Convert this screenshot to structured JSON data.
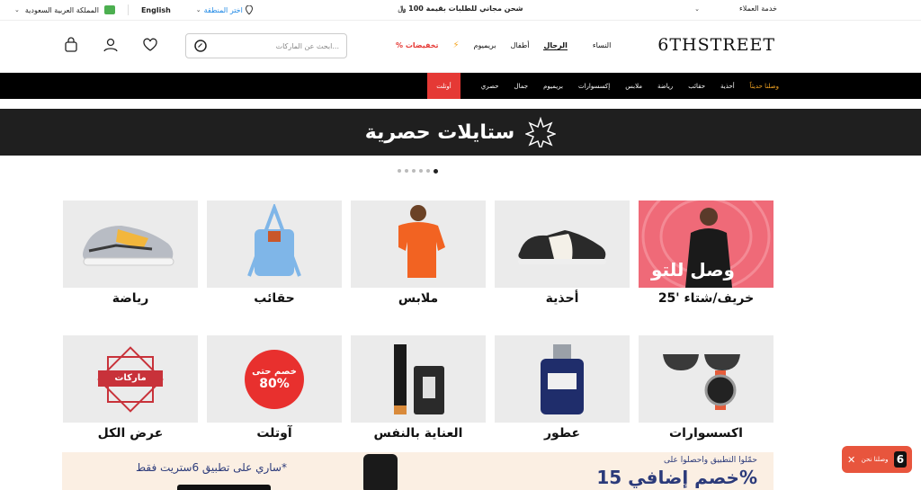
{
  "topbar": {
    "country": "المملكة العربية السعودية",
    "language": "English",
    "region": "اختر المنطقة",
    "shipping": "شحن مجاني للطلبات بقيمة 100 ﷼",
    "customer_service": "خدمة العملاء"
  },
  "header": {
    "logo": "6THSTREET",
    "search_placeholder": "ابحث عن الماركات...",
    "categories": {
      "women": "النساء",
      "men": "الرجال",
      "kids": "أطفال",
      "premium": "بريميوم",
      "sale": "% تخفيضات"
    }
  },
  "nav": {
    "items": [
      "وصلنا حديثاً",
      "أحذية",
      "حقائب",
      "رياضة",
      "ملابس",
      "إكسسوارات",
      "بريميوم",
      "جمال",
      "حصري"
    ],
    "outlet": "أوتلت"
  },
  "banner": {
    "title": "ستايلات حصرية"
  },
  "carousel": {
    "slides": 6,
    "active": 5
  },
  "tiles": [
    {
      "label": "خريف/شتاء '25",
      "overlay": "وصل للتو"
    },
    {
      "label": "أحذية"
    },
    {
      "label": "ملابس"
    },
    {
      "label": "حقائب"
    },
    {
      "label": "رياضة"
    },
    {
      "label": "اكسسوارات"
    },
    {
      "label": "عطور"
    },
    {
      "label": "العناية بالنفس"
    },
    {
      "label": "آوتلت",
      "badge_line1": "خصم حتى",
      "badge_line2": "80%"
    },
    {
      "label": "عرض الكل",
      "badge": "ماركات"
    }
  ],
  "promo": {
    "line1": "حمّلوا التطبيق واحصلوا على",
    "big": "خصم إضافي 15%",
    "left": "ساري على تطبيق 6ستريت فقط*"
  },
  "chat": {
    "label": "وصلنا نحن"
  },
  "colors": {
    "accent_red": "#e53935",
    "nav_bg": "#000000",
    "banner_bg": "#1f1f1f",
    "new_in": "#f5a623"
  }
}
